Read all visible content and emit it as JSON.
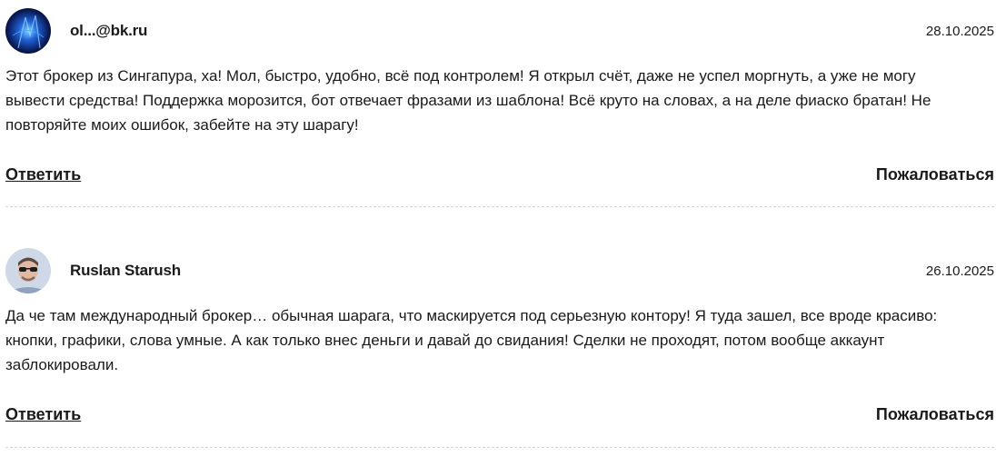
{
  "comments": [
    {
      "author": "ol...@bk.ru",
      "date": "28.10.2025",
      "text": "Этот брокер из Сингапура, ха! Мол, быстро, удобно, всё под контролем! Я открыл счёт, даже не успел моргнуть, а уже не могу вывести средства! Поддержка морозится, бот отвечает фразами из шаблона! Всё круто на словах, а на деле фиаско братан! Не повторяйте моих ошибок, забейте на эту шарагу!",
      "reply_label": "Ответить",
      "report_label": "Пожаловаться",
      "avatar_icon": "abstract-blue-avatar"
    },
    {
      "author": "Ruslan Starush",
      "date": "26.10.2025",
      "text": "Да че там международный брокер… обычная шарага, что маскируется под серьезную контору! Я туда зашел, все вроде красиво: кнопки, графики, слова умные. А как только внес деньги и давай до свидания! Сделки не проходят, потом вообще аккаунт заблокировали.",
      "reply_label": "Ответить",
      "report_label": "Пожаловаться",
      "avatar_icon": "user-photo-avatar"
    }
  ]
}
